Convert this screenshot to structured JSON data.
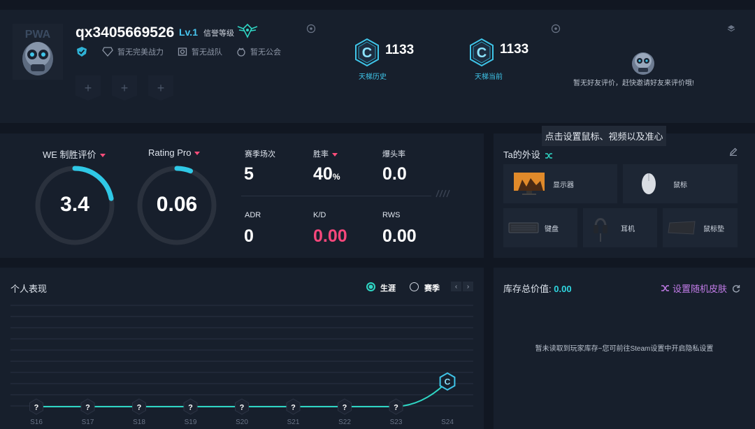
{
  "profile": {
    "username": "qx3405669526",
    "level": "Lv.1",
    "credit_label": "信誉等级",
    "tags": [
      "暂无完美战力",
      "暂无战队",
      "暂无公会"
    ],
    "slot_symbol": "+",
    "ladder": [
      {
        "letter": "C",
        "value": "1133",
        "label": "天梯历史"
      },
      {
        "letter": "C",
        "value": "1133",
        "label": "天梯当前"
      }
    ],
    "friend_text": "暂无好友评价，赶快邀请好友来评价哦!"
  },
  "tooltip": "点击设置鼠标、视频以及准心",
  "stats": {
    "we_title": "WE 制胜评价",
    "we_value": "3.4",
    "we_fraction": 0.22,
    "rating_title": "Rating Pro",
    "rating_value": "0.06",
    "rating_fraction": 0.06,
    "season_matches_label": "赛季场次",
    "season_matches": "5",
    "win_rate_label": "胜率",
    "win_rate": "40",
    "win_rate_unit": "%",
    "headshot_label": "爆头率",
    "headshot": "0.0",
    "adr_label": "ADR",
    "adr": "0",
    "kd_label": "K/D",
    "kd": "0.00",
    "rws_label": "RWS",
    "rws": "0.00"
  },
  "peripherals": {
    "title": "Ta的外设",
    "items": [
      "显示器",
      "鼠标",
      "键盘",
      "耳机",
      "鼠标垫"
    ]
  },
  "performance": {
    "title": "个人表现",
    "option_career": "生涯",
    "option_season": "赛季",
    "prev": "‹",
    "next": "›",
    "seasons": [
      "S16",
      "S17",
      "S18",
      "S19",
      "S20",
      "S21",
      "S22",
      "S23",
      "S24"
    ],
    "marker_unknown": "?",
    "marker_last": "C"
  },
  "inventory": {
    "title": "库存总价值:",
    "value": "0.00",
    "random_skin": "设置随机皮肤",
    "empty_text": "暂未读取到玩家库存~您可前往Steam设置中开启隐私设置"
  },
  "colors": {
    "accent_cyan": "#2fd6c4",
    "ladder_blue": "#3fc4e8",
    "pink": "#f5477b",
    "purple": "#c27ce8",
    "panel": "#171f2c",
    "background": "#111722"
  }
}
